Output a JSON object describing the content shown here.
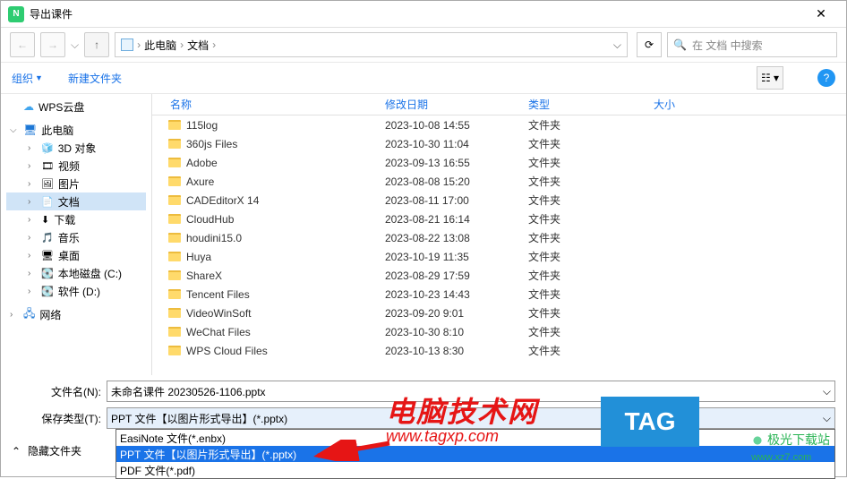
{
  "window": {
    "title": "导出课件",
    "app_icon_letter": "N"
  },
  "breadcrumb": {
    "root": "此电脑",
    "folder": "文档",
    "search_placeholder": "在 文档 中搜索"
  },
  "toolbar": {
    "organize": "组织",
    "new_folder": "新建文件夹"
  },
  "sidebar": {
    "wps": "WPS云盘",
    "pc": "此电脑",
    "items": [
      {
        "label": "3D 对象",
        "icon": "cube"
      },
      {
        "label": "视频",
        "icon": "film"
      },
      {
        "label": "图片",
        "icon": "image"
      },
      {
        "label": "文档",
        "icon": "doc",
        "selected": true
      },
      {
        "label": "下载",
        "icon": "download"
      },
      {
        "label": "音乐",
        "icon": "music"
      },
      {
        "label": "桌面",
        "icon": "desktop"
      },
      {
        "label": "本地磁盘 (C:)",
        "icon": "disk"
      },
      {
        "label": "软件 (D:)",
        "icon": "disk"
      }
    ],
    "network": "网络"
  },
  "columns": {
    "name": "名称",
    "date": "修改日期",
    "type": "类型",
    "size": "大小"
  },
  "files": [
    {
      "name": "115log",
      "date": "2023-10-08 14:55",
      "type": "文件夹"
    },
    {
      "name": "360js Files",
      "date": "2023-10-30 11:04",
      "type": "文件夹"
    },
    {
      "name": "Adobe",
      "date": "2023-09-13 16:55",
      "type": "文件夹"
    },
    {
      "name": "Axure",
      "date": "2023-08-08 15:20",
      "type": "文件夹"
    },
    {
      "name": "CADEditorX 14",
      "date": "2023-08-11 17:00",
      "type": "文件夹"
    },
    {
      "name": "CloudHub",
      "date": "2023-08-21 16:14",
      "type": "文件夹"
    },
    {
      "name": "houdini15.0",
      "date": "2023-08-22 13:08",
      "type": "文件夹"
    },
    {
      "name": "Huya",
      "date": "2023-10-19 11:35",
      "type": "文件夹"
    },
    {
      "name": "ShareX",
      "date": "2023-08-29 17:59",
      "type": "文件夹"
    },
    {
      "name": "Tencent Files",
      "date": "2023-10-23 14:43",
      "type": "文件夹"
    },
    {
      "name": "VideoWinSoft",
      "date": "2023-09-20 9:01",
      "type": "文件夹"
    },
    {
      "name": "WeChat Files",
      "date": "2023-10-30 8:10",
      "type": "文件夹"
    },
    {
      "name": "WPS Cloud Files",
      "date": "2023-10-13 8:30",
      "type": "文件夹"
    }
  ],
  "fields": {
    "filename_label": "文件名(N):",
    "filename_value": "未命名课件 20230526-1106.pptx",
    "filetype_label": "保存类型(T):",
    "filetype_value": "PPT 文件【以图片形式导出】(*.pptx)"
  },
  "filetype_options": [
    {
      "label": "EasiNote 文件(*.enbx)",
      "selected": false
    },
    {
      "label": "PPT 文件【以图片形式导出】(*.pptx)",
      "selected": true
    },
    {
      "label": "PDF 文件(*.pdf)",
      "selected": false
    }
  ],
  "footer": {
    "hide_folders": "隐藏文件夹"
  },
  "watermark": {
    "title": "电脑技术网",
    "url": "www.tagxp.com",
    "tag": "TAG",
    "site": "极光下载站",
    "site_url": "www.xz7.com"
  }
}
